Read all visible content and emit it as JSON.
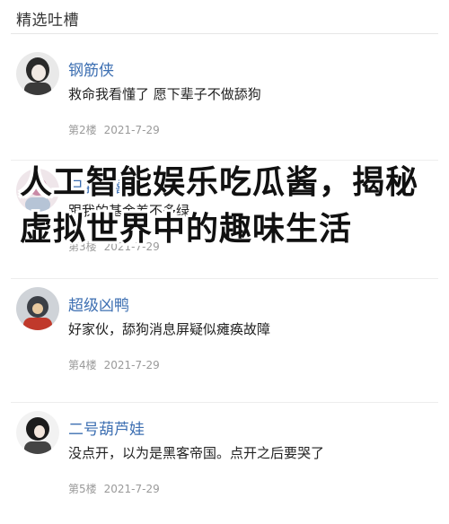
{
  "section": {
    "title": "精选吐槽"
  },
  "comments": [
    {
      "username": "钢筋侠",
      "content": "救命我看懂了 愿下辈子不做舔狗",
      "floor": "第2楼",
      "date": "2021-7-29"
    },
    {
      "username": "只我够喜欢",
      "content": "跟我的基金差不多绿",
      "floor": "第3楼",
      "date": "2021-7-29"
    },
    {
      "username": "超级凶鸭",
      "content": "好家伙，舔狗消息屏疑似瘫痪故障",
      "floor": "第4楼",
      "date": "2021-7-29"
    },
    {
      "username": "二号葫芦娃",
      "content": "没点开，以为是黑客帝国。点开之后要哭了",
      "floor": "第5楼",
      "date": "2021-7-29"
    }
  ],
  "overlay": {
    "title": "人工智能娱乐吃瓜酱，揭秘虚拟世界中的趣味生活"
  },
  "colors": {
    "username": "#3d6fb2",
    "text": "#222222",
    "meta": "#9a9a9a"
  }
}
